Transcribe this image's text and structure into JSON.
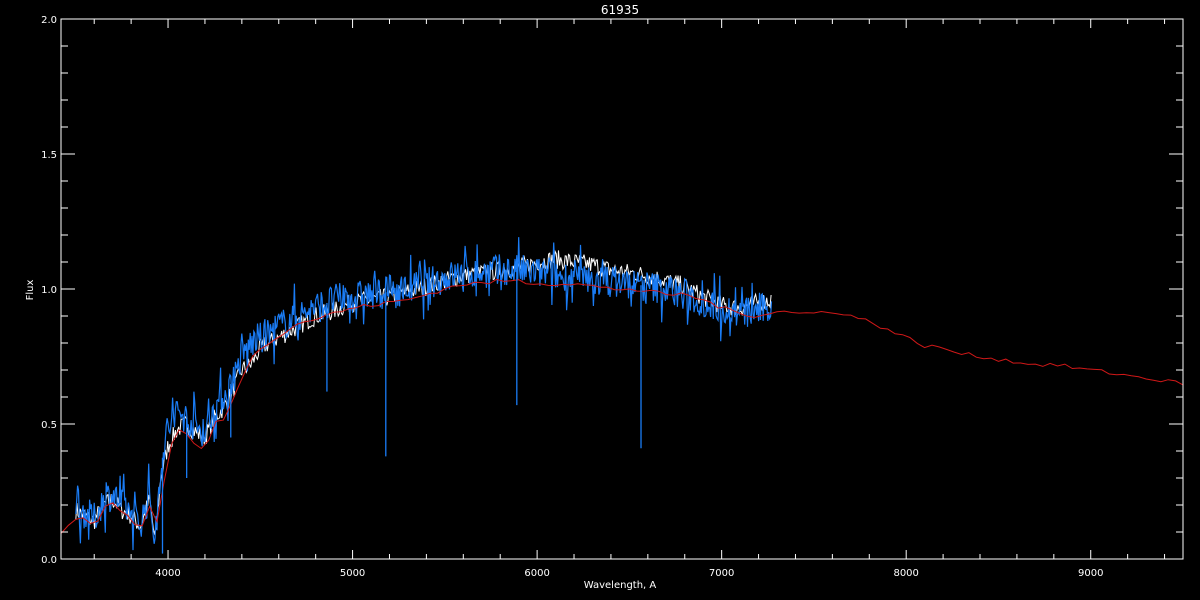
{
  "chart_data": {
    "type": "line",
    "title": "61935",
    "xlabel": "Wavelength, A",
    "ylabel": "Flux",
    "xlim": [
      3420,
      9500
    ],
    "ylim": [
      0.0,
      2.0
    ],
    "grid": false,
    "legend": "none",
    "background": "#000000",
    "axis_color": "#ffffff",
    "x_ticks": [
      {
        "value": 4000,
        "label": "4000"
      },
      {
        "value": 5000,
        "label": "5000"
      },
      {
        "value": 6000,
        "label": "6000"
      },
      {
        "value": 7000,
        "label": "7000"
      },
      {
        "value": 8000,
        "label": "8000"
      },
      {
        "value": 9000,
        "label": "9000"
      }
    ],
    "y_ticks": [
      {
        "value": 0.0,
        "label": "0.0"
      },
      {
        "value": 0.5,
        "label": "0.5"
      },
      {
        "value": 1.0,
        "label": "1.0"
      },
      {
        "value": 1.5,
        "label": "1.5"
      },
      {
        "value": 2.0,
        "label": "2.0"
      }
    ],
    "x_minor_step": 200,
    "y_minor_step": 0.1,
    "series": [
      {
        "color": "#ffffff",
        "x": [
          3500,
          3550,
          3600,
          3650,
          3700,
          3750,
          3800,
          3850,
          3900,
          3930,
          3960,
          4000,
          4050,
          4100,
          4150,
          4200,
          4250,
          4300,
          4350,
          4400,
          4450,
          4500,
          4600,
          4700,
          4800,
          4900,
          5000,
          5100,
          5200,
          5300,
          5400,
          5500,
          5600,
          5700,
          5800,
          5900,
          6000,
          6100,
          6200,
          6300,
          6400,
          6500,
          6600,
          6700,
          6800,
          6900,
          7000,
          7100,
          7200,
          7270
        ],
        "y": [
          0.18,
          0.16,
          0.14,
          0.2,
          0.22,
          0.18,
          0.16,
          0.12,
          0.22,
          0.06,
          0.3,
          0.42,
          0.48,
          0.5,
          0.47,
          0.45,
          0.52,
          0.56,
          0.62,
          0.7,
          0.72,
          0.78,
          0.82,
          0.86,
          0.9,
          0.92,
          0.95,
          0.96,
          0.97,
          0.99,
          1.01,
          1.03,
          1.05,
          1.06,
          1.07,
          1.08,
          1.1,
          1.11,
          1.1,
          1.09,
          1.07,
          1.06,
          1.05,
          1.03,
          1.01,
          0.97,
          0.94,
          0.93,
          0.95,
          0.96
        ]
      },
      {
        "color": "#1a7cf5",
        "x": [
          3500,
          3550,
          3600,
          3650,
          3700,
          3750,
          3800,
          3850,
          3900,
          3930,
          3960,
          4000,
          4050,
          4100,
          4150,
          4200,
          4250,
          4300,
          4350,
          4400,
          4450,
          4500,
          4600,
          4700,
          4800,
          4900,
          5000,
          5100,
          5200,
          5300,
          5400,
          5500,
          5600,
          5700,
          5800,
          5900,
          6000,
          6100,
          6200,
          6300,
          6400,
          6500,
          6600,
          6700,
          6800,
          6900,
          7000,
          7100,
          7200,
          7270
        ],
        "y": [
          0.19,
          0.17,
          0.15,
          0.22,
          0.24,
          0.2,
          0.17,
          0.13,
          0.24,
          0.06,
          0.34,
          0.48,
          0.55,
          0.52,
          0.49,
          0.47,
          0.56,
          0.6,
          0.66,
          0.75,
          0.8,
          0.82,
          0.86,
          0.9,
          0.93,
          0.96,
          0.97,
          0.98,
          0.99,
          1.0,
          1.02,
          1.04,
          1.06,
          1.06,
          1.07,
          1.07,
          1.06,
          1.05,
          1.04,
          1.03,
          1.03,
          1.02,
          1.01,
          1.0,
          0.98,
          0.95,
          0.93,
          0.91,
          0.92,
          0.93
        ]
      },
      {
        "color": "#d01818",
        "x": [
          3420,
          3500,
          3550,
          3600,
          3650,
          3700,
          3750,
          3800,
          3850,
          3900,
          3950,
          4000,
          4050,
          4100,
          4150,
          4200,
          4250,
          4300,
          4350,
          4400,
          4450,
          4500,
          4600,
          4700,
          4800,
          4900,
          5000,
          5100,
          5200,
          5300,
          5400,
          5500,
          5600,
          5700,
          5800,
          5900,
          6000,
          6100,
          6200,
          6300,
          6400,
          6500,
          6600,
          6700,
          6800,
          6900,
          7000,
          7100,
          7200,
          7300,
          7400,
          7500,
          7600,
          7700,
          7800,
          7900,
          8000,
          8100,
          8200,
          8300,
          8400,
          8500,
          8600,
          8700,
          8800,
          8900,
          9000,
          9100,
          9200,
          9300,
          9400,
          9500
        ],
        "y": [
          0.1,
          0.14,
          0.16,
          0.12,
          0.19,
          0.2,
          0.18,
          0.15,
          0.1,
          0.2,
          0.12,
          0.4,
          0.48,
          0.46,
          0.42,
          0.4,
          0.5,
          0.52,
          0.58,
          0.68,
          0.74,
          0.78,
          0.83,
          0.87,
          0.89,
          0.91,
          0.93,
          0.94,
          0.95,
          0.96,
          0.98,
          1.0,
          1.02,
          1.02,
          1.03,
          1.03,
          1.02,
          1.02,
          1.02,
          1.01,
          1.0,
          1.0,
          0.99,
          0.98,
          0.98,
          0.96,
          0.93,
          0.91,
          0.9,
          0.92,
          0.91,
          0.91,
          0.92,
          0.9,
          0.88,
          0.85,
          0.82,
          0.79,
          0.78,
          0.76,
          0.75,
          0.74,
          0.73,
          0.72,
          0.72,
          0.71,
          0.7,
          0.69,
          0.68,
          0.67,
          0.66,
          0.65
        ]
      },
      {
        "color": "#1a7cf5",
        "x": [
          3420,
          4000,
          5000,
          6000,
          7000,
          7270
        ],
        "y": [
          0.0,
          0.0,
          0.0,
          0.0,
          0.0,
          0.0
        ]
      }
    ],
    "absorption_lines": [
      {
        "x": 5180,
        "y": 0.38
      },
      {
        "x": 5890,
        "y": 0.57
      },
      {
        "x": 6563,
        "y": 0.41
      },
      {
        "x": 4861,
        "y": 0.62
      },
      {
        "x": 4340,
        "y": 0.45
      },
      {
        "x": 3970,
        "y": 0.02
      },
      {
        "x": 4101,
        "y": 0.3
      }
    ]
  }
}
